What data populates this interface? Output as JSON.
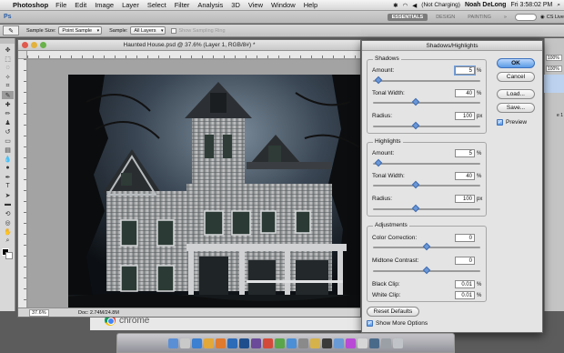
{
  "menubar": {
    "app": "Photoshop",
    "items": [
      "File",
      "Edit",
      "Image",
      "Layer",
      "Select",
      "Filter",
      "Analysis",
      "3D",
      "View",
      "Window",
      "Help"
    ],
    "battery": "(Not Charging)",
    "user": "Noah DeLong",
    "clock": "Fri 3:58:02 PM"
  },
  "appbar": {
    "workspaces": [
      "ESSENTIALS",
      "DESIGN",
      "PAINTING"
    ],
    "cs_live": "CS Live"
  },
  "options": {
    "sample_size_label": "Sample Size:",
    "sample_size_value": "Point Sample",
    "sample_label": "Sample:",
    "sample_value": "All Layers",
    "show_ring_label": "Show Sampling Ring"
  },
  "document": {
    "title": "Haunted House.psd @ 37.6% (Layer 1, RGB/8#) *",
    "zoom": "37.6%",
    "doc_info": "Doc: 2.74M/24.8M"
  },
  "panels": {
    "field1": "100%",
    "field2": "100%",
    "label": "e 1"
  },
  "dialog": {
    "title": "Shadows/Highlights",
    "shadows": {
      "label": "Shadows",
      "amount_label": "Amount:",
      "amount": "5",
      "amount_unit": "%",
      "tonal_label": "Tonal Width:",
      "tonal": "40",
      "tonal_unit": "%",
      "radius_label": "Radius:",
      "radius": "100",
      "radius_unit": "px"
    },
    "highlights": {
      "label": "Highlights",
      "amount_label": "Amount:",
      "amount": "5",
      "amount_unit": "%",
      "tonal_label": "Tonal Width:",
      "tonal": "40",
      "tonal_unit": "%",
      "radius_label": "Radius:",
      "radius": "100",
      "radius_unit": "px"
    },
    "adjustments": {
      "label": "Adjustments",
      "color_label": "Color Correction:",
      "color": "0",
      "midtone_label": "Midtone Contrast:",
      "midtone": "0",
      "black_label": "Black Clip:",
      "black": "0.01",
      "black_unit": "%",
      "white_label": "White Clip:",
      "white": "0.01",
      "white_unit": "%"
    },
    "buttons": {
      "ok": "OK",
      "cancel": "Cancel",
      "load": "Load...",
      "save": "Save...",
      "preview": "Preview",
      "reset": "Reset Defaults",
      "more": "Show More Options"
    },
    "slider_levels": {
      "shadow_amount": 0.05,
      "shadow_tonal": 0.4,
      "shadow_radius": 0.4,
      "highlight_amount": 0.05,
      "highlight_tonal": 0.4,
      "highlight_radius": 0.4,
      "color": 0.5,
      "midtone": 0.5
    }
  },
  "chrome": {
    "word": "chrome"
  }
}
